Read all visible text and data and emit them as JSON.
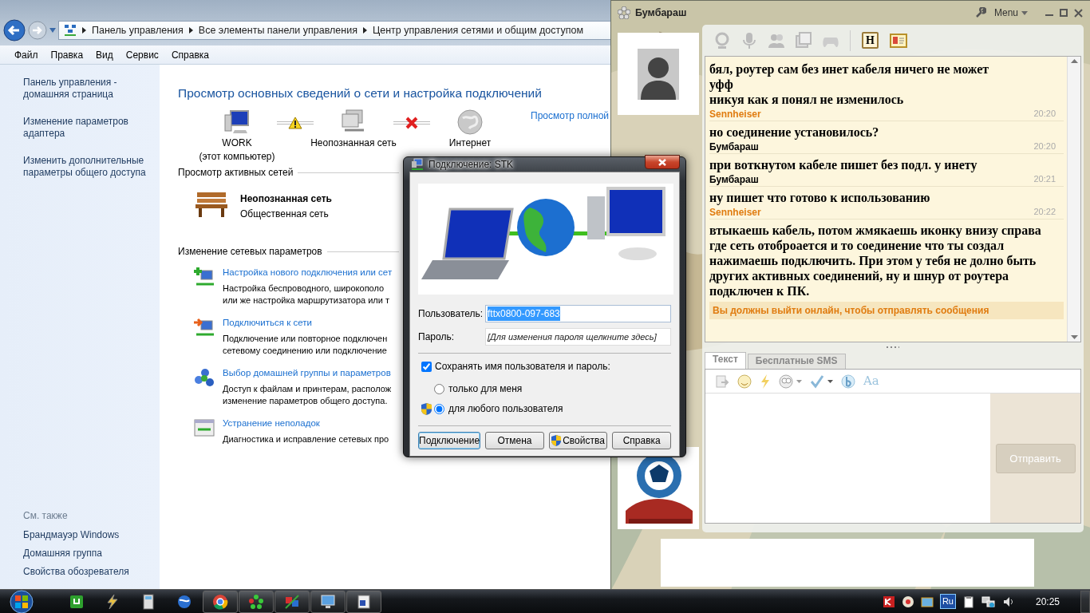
{
  "explorer": {
    "breadcrumb": [
      "Панель управления",
      "Все элементы панели управления",
      "Центр управления сетями и общим доступом"
    ],
    "menu": [
      "Файл",
      "Правка",
      "Вид",
      "Сервис",
      "Справка"
    ],
    "sidebar": {
      "links": [
        "Панель управления - домашняя страница",
        "Изменение параметров адаптера",
        "Изменить дополнительные параметры общего доступа"
      ],
      "see_also_title": "См. также",
      "see_also": [
        "Брандмауэр Windows",
        "Домашняя группа",
        "Свойства обозревателя"
      ]
    },
    "heading": "Просмотр основных сведений о сети и настройка подключений",
    "map": {
      "nodes": [
        {
          "label": "WORK",
          "sublabel": "(этот компьютер)",
          "kind": "computer"
        },
        {
          "label": "Неопознанная сеть",
          "kind": "network"
        },
        {
          "label": "Интернет",
          "kind": "internet"
        }
      ],
      "links": [
        {
          "kind": "warning"
        },
        {
          "kind": "error"
        }
      ],
      "full_map_link": "Просмотр полной"
    },
    "active_networks": {
      "title": "Просмотр активных сетей",
      "name": "Неопознанная сеть",
      "type": "Общественная сеть"
    },
    "settings": {
      "title": "Изменение сетевых параметров",
      "tasks": [
        {
          "kind": "new",
          "title": "Настройка нового подключения или сет",
          "lines": [
            "Настройка беспроводного, широкополо",
            "или же настройка маршрутизатора или т"
          ]
        },
        {
          "kind": "connect",
          "title": "Подключиться к сети",
          "lines": [
            "Подключение или повторное подключен",
            "сетевому соединению или подключение"
          ]
        },
        {
          "kind": "homegroup",
          "title": "Выбор домашней группы и параметров",
          "lines": [
            "Доступ к файлам и принтерам, располож",
            "изменение параметров общего доступа."
          ]
        },
        {
          "kind": "troubleshoot",
          "title": "Устранение неполадок",
          "lines": [
            "Диагностика и исправление сетевых про"
          ]
        }
      ]
    }
  },
  "dialog": {
    "title": "Подключение: STK",
    "user_label": "Пользователь:",
    "user_value": "fttx0800-097-683",
    "password_label": "Пароль:",
    "password_placeholder": "[Для изменения пароля щелкните здесь]",
    "save": {
      "label": "Сохранять имя пользователя и пароль:",
      "checked": true
    },
    "radios": [
      {
        "label": "только для меня",
        "selected": false,
        "shield": false
      },
      {
        "label": "для любого пользователя",
        "selected": true,
        "shield": true
      }
    ],
    "buttons": [
      {
        "label": "Подключение",
        "default": true,
        "shield": false
      },
      {
        "label": "Отмена",
        "default": false,
        "shield": false
      },
      {
        "label": "Свойства",
        "default": false,
        "shield": true
      },
      {
        "label": "Справка",
        "default": false,
        "shield": false
      }
    ]
  },
  "chat": {
    "title": "Бумбараш",
    "menu": "Menu",
    "history_button": "H",
    "messages": [
      {
        "text": [
          "бял, роутер сам без инет кабеля ничего не может",
          "уфф",
          "никуя как я понял не изменилось"
        ],
        "author": "Sennheiser",
        "time": "20:20",
        "kind": "contact"
      },
      {
        "text": [
          "но соединение установилось?"
        ],
        "author": "Бумбараш",
        "time": "20:20",
        "kind": "self"
      },
      {
        "text": [
          "при воткнутом кабеле пишет без подл. у инету"
        ],
        "author": "Бумбараш",
        "time": "20:21",
        "kind": "self"
      },
      {
        "text": [
          "ну пишет что готово к использованию"
        ],
        "author": "Sennheiser",
        "time": "20:22",
        "kind": "contact"
      },
      {
        "text": [
          "втыкаешь кабель, потом жмякаешь иконку внизу справа где сеть отоброается и то соединение что ты создал нажимаешь подключить. При этом у тебя не долно быть других активных соединений, ну и шнур от роутера подключен к ПК."
        ]
      }
    ],
    "notice": "Вы должны выйти онлайн, чтобы отправлять сообщения",
    "tabs": [
      {
        "label": "Текст",
        "selected": true
      },
      {
        "label": "Бесплатные SMS",
        "selected": false
      }
    ],
    "font_button": "Aa",
    "send_button": {
      "label": "Отправить",
      "disabled": true
    }
  },
  "taskbar": {
    "apps": [
      {
        "open": false
      },
      {
        "open": false
      },
      {
        "open": false
      },
      {
        "open": false
      },
      {
        "open": true
      },
      {
        "open": true
      },
      {
        "open": true
      },
      {
        "open": true
      },
      {
        "open": true
      }
    ],
    "language": "Ru",
    "clock": "20:25"
  }
}
